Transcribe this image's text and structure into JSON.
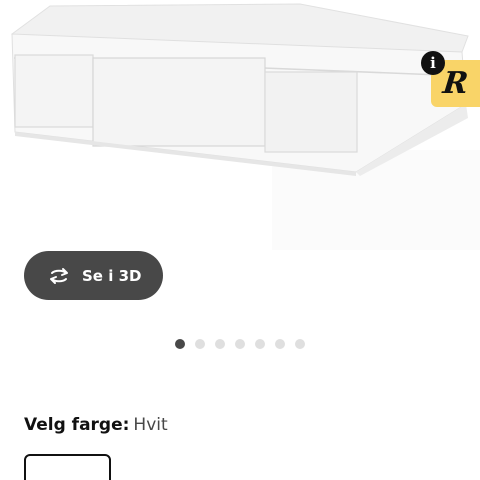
{
  "product": {
    "image_icon": "white-storage-case-image",
    "badge_info": "i",
    "badge_logo": "R"
  },
  "view3d": {
    "label": "Se i 3D",
    "icon": "rotate-3d-icon"
  },
  "carousel": {
    "total": 7,
    "active_index": 0
  },
  "color": {
    "label": "Velg farge:",
    "value": "Hvit"
  },
  "colors": {
    "button_bg": "#484848",
    "badge_yellow": "#f9d468",
    "dot_inactive": "#dfdfdf"
  }
}
